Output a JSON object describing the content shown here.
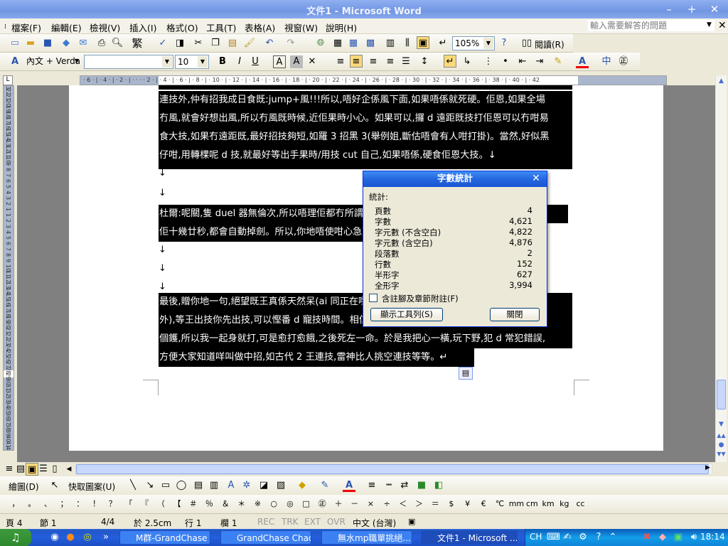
{
  "window": {
    "title": "文件1 - Microsoft Word"
  },
  "menubar": {
    "items": [
      "檔案(F)",
      "編輯(E)",
      "檢視(V)",
      "插入(I)",
      "格式(O)",
      "工具(T)",
      "表格(A)",
      "視窗(W)",
      "說明(H)"
    ],
    "help_placeholder": "輸入需要解答的問題"
  },
  "standard_toolbar": {
    "zoom": "105%",
    "reading": "閱讀(R)"
  },
  "format_toolbar": {
    "style": "內文 + Verda",
    "font": "",
    "size": "10"
  },
  "ruler": {
    "marks": "· 6 · | · 4 · | · 2 · | · · · · 2 · | · 4 · | · 6 · | · 8 · | · 10 · | · 12 · | · 14 · | · 16 · | · 18 · | · 20 · | · 22 · | · 24 · | · 26 · | · 28 · | · 30 · | · 32 · | · 34 · | · 36 · | · 38 · | · 40 · | · 42"
  },
  "vruler": {
    "marks": [
      "23",
      "22",
      "21",
      "20",
      "19",
      "18",
      "17",
      "16",
      "15",
      "14",
      "13",
      "12",
      "11",
      "10",
      "9",
      "8",
      "7",
      "6",
      "5",
      "4",
      "3",
      "2",
      "1",
      "1",
      "2",
      "3",
      "4",
      "5",
      "6",
      "7",
      "8",
      "9",
      "10",
      "11",
      "12",
      "13",
      "14",
      "15",
      "16",
      "17",
      "18",
      "19",
      "20",
      "21",
      "22",
      "23",
      "24",
      "25",
      "26",
      "27",
      "28",
      "29",
      "30",
      "31",
      "32",
      "33",
      "34",
      "35",
      "36",
      "37",
      "38",
      "39",
      "40",
      "41",
      "42"
    ]
  },
  "document": {
    "lines": [
      "連技外,仲有招我成日食既:jump+風!!!所以,唔好企係風下面,如果唔係就死硬。佢恩,如果全場",
      "冇風,就會好想出風,所以冇風既時候,近佢果時小心。如果可以,攞 d 遠距既技打佢恩可以冇咁易",
      "食大技,如果冇遠距既,最好招技夠短,如羅 3 招黑 3(舉例姐,斷估唔會有人咁打掛)。當然,好似黑",
      "仔咁,用轉棵呢 d 技,就最好等出手果時/用技 cut 自己,如果唔係,硬食佢恩大技。↓",
      "↓",
      "↓",
      "杜爾:呢關,隻 duel 器無倫次,所以唔理佢都冇所謂,佢打你招式時,又快又痛又遠,所以你等",
      "佢十幾廿秒,都會自動掉劍。所以,你地唔使咁心急,",
      "↓",
      "↓",
      "↓",
      "最後,贈你地一句,絕望既王真係天然呆(ai 同正在嚟),隻王要打佢,打到佢,佢會等王除",
      "外),等王出技你先出技,可以慳番 d 寵技時間。相信,佢會等王出技,同埋你地等王,佢又果打 4",
      "個鑊,所以我一起身就打,可是愈打愈餓,之後死左一命。於是我把心一橫,玩下野,犯 d 常犯錯誤,",
      "方便大家知道咩叫做中招,如古代 2 王連技,雷神比人挑空連技等等。↵"
    ]
  },
  "dialog": {
    "title": "字數統計",
    "section": "統計:",
    "rows": [
      {
        "label": "頁數",
        "value": "4"
      },
      {
        "label": "字數",
        "value": "4,621"
      },
      {
        "label": "字元數 (不含空白)",
        "value": "4,822"
      },
      {
        "label": "字元數 (含空白)",
        "value": "4,876"
      },
      {
        "label": "段落數",
        "value": "2"
      },
      {
        "label": "行數",
        "value": "152"
      },
      {
        "label": "半形字",
        "value": "627"
      },
      {
        "label": "全形字",
        "value": "3,994"
      }
    ],
    "checkbox_label": "含註腳及章節附註(F)",
    "show_toolbar": "顯示工具列(S)",
    "close": "關閉"
  },
  "drawbar": {
    "draw": "繪圖(D)",
    "autoshapes": "快取圖案(U)"
  },
  "symbols": [
    "，",
    "。",
    "、",
    "；",
    "：",
    "！",
    "？",
    "「",
    "『",
    "（",
    "【",
    "＃",
    "％",
    "＆",
    "＊",
    "※",
    "○",
    "◎",
    "□",
    "㊣",
    "＋",
    "－",
    "×",
    "÷",
    "＜",
    "＞",
    "＝",
    "$",
    "¥",
    "€",
    "℃",
    "mm",
    "cm",
    "km",
    "kg",
    "cc"
  ],
  "status": {
    "page": "頁 4",
    "section": "節 1",
    "pages": "4/4",
    "at": "於 2.5cm",
    "line": "行 1",
    "col": "欄 1",
    "rec": "REC",
    "trk": "TRK",
    "ext": "EXT",
    "ovr": "OVR",
    "lang": "中文 (台灣)"
  },
  "taskbar": {
    "tasks": [
      "M群-GrandChase ...",
      "GrandChase Chaos ...",
      "無水mp職單挑絕...",
      "文件1 - Microsoft ..."
    ],
    "lang": "CH",
    "clock": "18:14"
  }
}
